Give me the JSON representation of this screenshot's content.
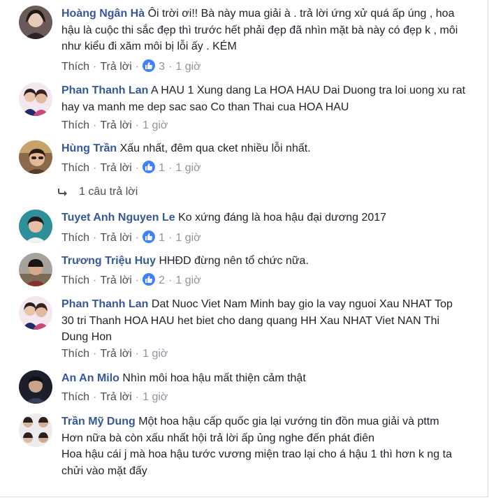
{
  "comments": [
    {
      "name": "Hoàng Ngân Hà",
      "text": "Ôi trời ơi!! Bà này mua giải à . trả lời ứng xử quá ấp úng , hoa hậu là cuộc thi sắc đẹp thì trước hết phải đẹp đã nhìn mặt bà này có đẹp k , môi như kiểu đi xăm môi bị lỗi ấy . KÉM",
      "like_label": "Thích",
      "reply_label": "Trả lời",
      "reactions": "3",
      "time": "1 giờ"
    },
    {
      "name": "Phan Thanh Lan",
      "text": "A HAU 1 Xung dang La HOA HAU Dai Duong tra loi uong xu rat hay va manh me dep sac sao Co than Thai cua HOA HAU",
      "like_label": "Thích",
      "reply_label": "Trả lời",
      "reactions": "",
      "time": "1 giờ"
    },
    {
      "name": "Hùng Trần",
      "text": "Xấu nhất, đêm qua cket nhiều lỗi nhất.",
      "like_label": "Thích",
      "reply_label": "Trả lời",
      "reactions": "1",
      "time": "1 giờ"
    },
    {
      "name": "Tuyet Anh Nguyen Le",
      "text": "Ko xứng đáng là hoa hậu đại dương 2017",
      "like_label": "Thích",
      "reply_label": "Trả lời",
      "reactions": "1",
      "time": "1 giờ"
    },
    {
      "name": "Trương Triệu Huy",
      "text": "HHĐD đừng nên tổ chức nữa.",
      "like_label": "Thích",
      "reply_label": "Trả lời",
      "reactions": "2",
      "time": "1 giờ"
    },
    {
      "name": "Phan Thanh Lan",
      "text": "Dat Nuoc Viet Nam Minh bay gio la vay nguoi Xau NHAT Top 30 tri Thanh HOA HAU het biet cho dang quang HH Xau NHAT Viet NAN Thi Dung Hon",
      "like_label": "Thích",
      "reply_label": "Trả lời",
      "reactions": "",
      "time": "1 giờ"
    },
    {
      "name": "An An Milo",
      "text": "Nhìn môi hoa hậu mất thiện cảm thật",
      "like_label": "Thích",
      "reply_label": "Trả lời",
      "reactions": "",
      "time": "1 giờ"
    },
    {
      "name": "Trần Mỹ Dung",
      "text": "Một hoa hậu cấp quốc gia lại vướng tin đồn mua giải và pttm",
      "text2": "Hơn nữa bà còn xấu nhất hội trả lời ấp ủng nghe đến phát điên",
      "text3": "Hoa hậu cái j mà hoa hậu tước vương miện trao lại cho á hậu 1 thì hơn k ng ta chửi vào mặt đấy"
    }
  ],
  "reply_thread": {
    "label": "1 câu trả lời"
  },
  "colors": {
    "name": "#365899",
    "text": "#1d2129",
    "meta": "#90949c",
    "like": "#4080ff"
  }
}
